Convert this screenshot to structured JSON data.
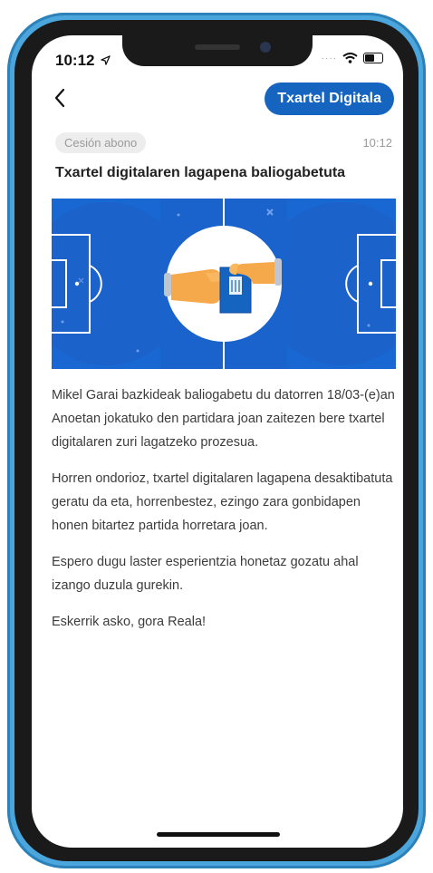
{
  "status_bar": {
    "time": "10:12"
  },
  "header": {
    "action_label": "Txartel Digitala"
  },
  "message": {
    "tag": "Cesión abono",
    "time": "10:12",
    "title": "Txartel digitalaren lagapena baliogabetuta",
    "paragraphs": [
      "Mikel Garai bazkideak baliogabetu du datorren 18/03-(e)an Anoetan jokatuko den partidara joan zaitezen bere txartel digitalaren zuri lagatzeko prozesua.",
      "Horren ondorioz, txartel digitalaren lagapena desaktibatuta geratu da eta, horrenbestez, ezingo zara gonbidapen honen bitartez partida horretara joan.",
      "Espero dugu laster esperientzia honetaz gozatu ahal izango duzula gurekin.",
      "Eskerrik asko, gora Reala!"
    ]
  },
  "colors": {
    "accent": "#1565c0",
    "field": "#1967d2",
    "frame": "#4aa6dd"
  },
  "icons": {
    "back": "chevron-left-icon",
    "location": "location-arrow-icon",
    "wifi": "wifi-icon",
    "battery": "battery-icon"
  }
}
